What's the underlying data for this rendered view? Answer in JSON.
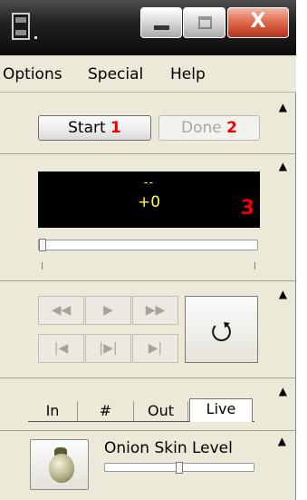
{
  "window": {
    "controls": {
      "minimize": "minimize",
      "maximize": "maximize",
      "close": "X"
    }
  },
  "menubar": {
    "items": [
      "Options",
      "Special",
      "Help"
    ]
  },
  "collapse_glyph": "▲",
  "record": {
    "start_label": "Start",
    "start_num": "1",
    "done_label": "Done",
    "done_num": "2"
  },
  "display": {
    "top_text": "--",
    "value": "+0",
    "num": "3"
  },
  "timeline": {
    "position_fraction": 0.0
  },
  "playback": {
    "rewind": "◀◀",
    "play": "▶",
    "fast_forward": "▶▶",
    "first_frame": "|◀",
    "step": "|▶|",
    "last_frame": "▶|",
    "loop": "⭯"
  },
  "tabs": [
    "In",
    "#",
    "Out",
    "Live"
  ],
  "active_tab": "Live",
  "onion": {
    "label": "Onion Skin Level",
    "level_fraction": 0.5
  },
  "colors": {
    "title_bar": "#1a1a1a",
    "panel_bg": "#ece9d8",
    "display_bg": "#000000",
    "display_text": "#ffff3a",
    "number_badge": "#ee0000"
  }
}
